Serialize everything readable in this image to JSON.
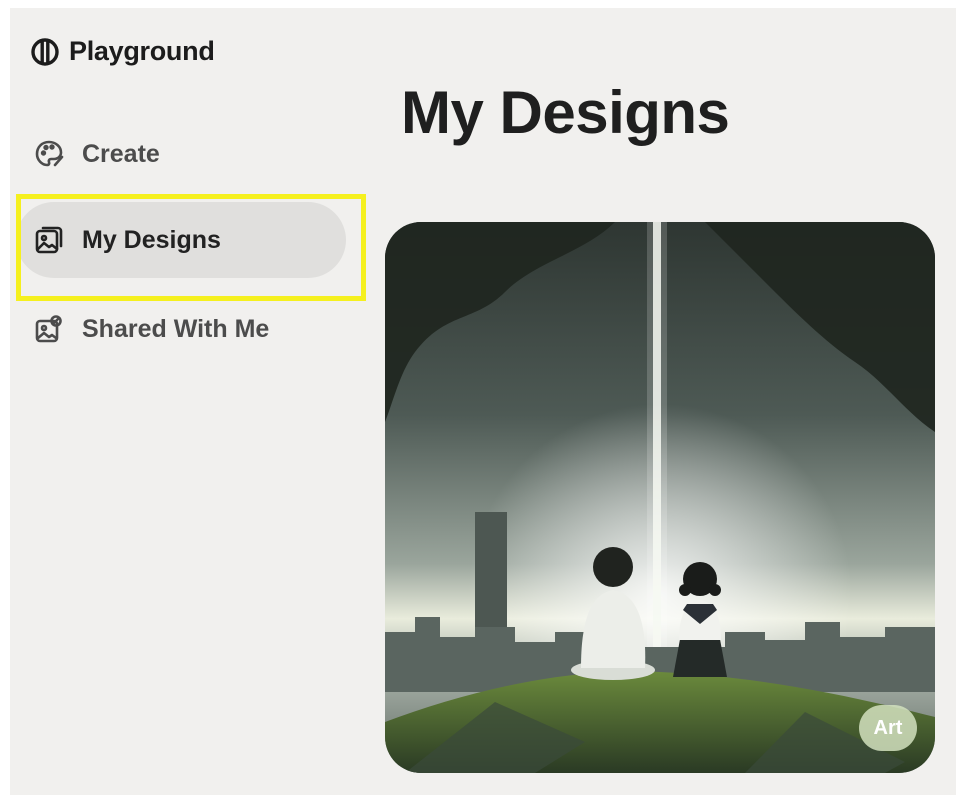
{
  "app": {
    "name": "Playground"
  },
  "sidebar": {
    "items": [
      {
        "label": "Create",
        "icon": "palette-icon"
      },
      {
        "label": "My Designs",
        "icon": "image-stack-icon",
        "selected": true
      },
      {
        "label": "Shared With Me",
        "icon": "shared-image-icon"
      }
    ]
  },
  "main": {
    "title": "My Designs",
    "designs": [
      {
        "badge": "Art"
      }
    ]
  },
  "colors": {
    "page_bg": "#f1f0ee",
    "selected_item_bg": "#e0dfdd",
    "highlight_outline": "#f5f01e",
    "text": "#1f1f1f"
  }
}
